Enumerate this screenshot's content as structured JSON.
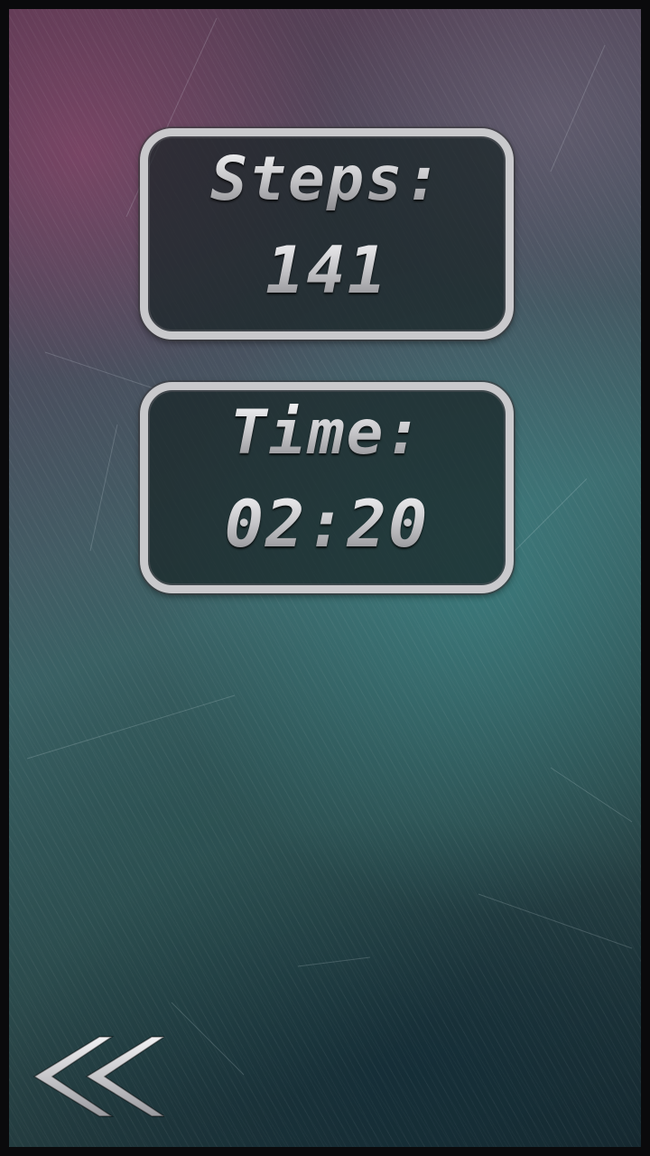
{
  "stats": {
    "steps_label": "Steps:",
    "steps_value": "141",
    "time_label": "Time:",
    "time_value": "02:20"
  },
  "icons": {
    "back": "double-chevron-left-icon"
  },
  "colors": {
    "panel_border": "#c9c9cc",
    "text": "#d4d4d6"
  }
}
